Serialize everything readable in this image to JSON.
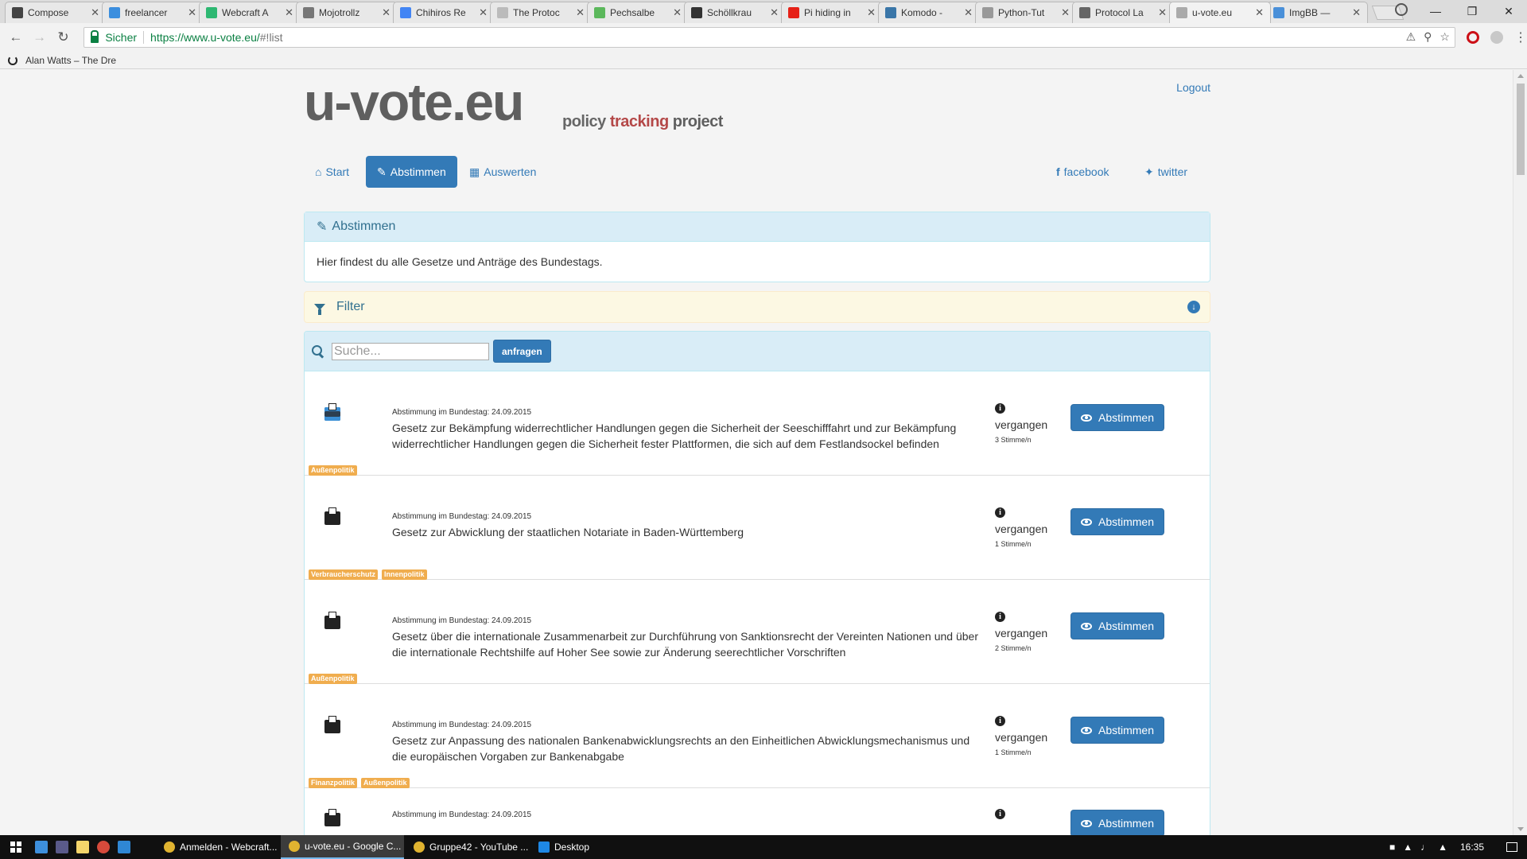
{
  "browser": {
    "tabs": [
      {
        "title": "Compose",
        "color": "#444"
      },
      {
        "title": "freelancer",
        "color": "#3b8ede"
      },
      {
        "title": "Webcraft A",
        "color": "#2eb872"
      },
      {
        "title": "Mojotrollz",
        "color": "#777"
      },
      {
        "title": "Chihiros Re",
        "color": "#4285f4"
      },
      {
        "title": "The Protoc",
        "color": "#bbb"
      },
      {
        "title": "Pechsalbe",
        "color": "#5cb85c"
      },
      {
        "title": "Schöllkrau",
        "color": "#333"
      },
      {
        "title": "Pi hiding in",
        "color": "#e62117"
      },
      {
        "title": "Komodo -",
        "color": "#3a76a8"
      },
      {
        "title": "Python-Tut",
        "color": "#999"
      },
      {
        "title": "Protocol La",
        "color": "#666"
      },
      {
        "title": "u-vote.eu",
        "color": "#aaa"
      },
      {
        "title": "ImgBB —",
        "color": "#4a90d9"
      }
    ],
    "secure_label": "Sicher",
    "url_host": "https://www.u-vote.eu/",
    "url_path": "#!list",
    "bookmark": "Alan Watts – The Dre"
  },
  "site": {
    "logo": "u-vote.eu",
    "tagline_policy": "policy",
    "tagline_tracking": "tracking",
    "tagline_project": "project",
    "logout": "Logout",
    "nav": {
      "start": "Start",
      "vote": "Abstimmen",
      "evaluate": "Auswerten",
      "facebook": "facebook",
      "twitter": "twitter"
    },
    "panel_title": "Abstimmen",
    "panel_text": "Hier findest du alle Gesetze und Anträge des Bundestags.",
    "filter_label": "Filter",
    "search_placeholder": "Suche...",
    "search_button": "anfragen",
    "vote_button": "Abstimmen",
    "status_past": "vergangen"
  },
  "items": [
    {
      "meta": "Abstimmung im Bundestag: 24.09.2015",
      "title": "Gesetz zur Bekämpfung widerrechtlicher Handlungen gegen die Sicherheit der Seeschifffahrt und zur Bekämpfung widerrechtlicher Handlungen gegen die Sicherheit fester Plattformen, die sich auf dem Festlandsockel befinden",
      "votes": "3 Stimme/n",
      "tags": [
        "Außenpolitik"
      ]
    },
    {
      "meta": "Abstimmung im Bundestag: 24.09.2015",
      "title": "Gesetz zur Abwicklung der staatlichen Notariate in Baden-Württemberg",
      "votes": "1 Stimme/n",
      "tags": [
        "Verbraucherschutz",
        "Innenpolitik"
      ]
    },
    {
      "meta": "Abstimmung im Bundestag: 24.09.2015",
      "title": "Gesetz über die internationale Zusammenarbeit zur Durchführung von Sanktionsrecht der Vereinten Nationen und über die internationale Rechtshilfe auf Hoher See sowie zur Änderung seerechtlicher Vorschriften",
      "votes": "2 Stimme/n",
      "tags": [
        "Außenpolitik"
      ]
    },
    {
      "meta": "Abstimmung im Bundestag: 24.09.2015",
      "title": "Gesetz zur Anpassung des nationalen Bankenabwicklungsrechts an den Einheitlichen Abwicklungsmechanismus und die europäischen Vorgaben zur Bankenabgabe",
      "votes": "1 Stimme/n",
      "tags": [
        "Finanzpolitik",
        "Außenpolitik"
      ]
    },
    {
      "meta": "Abstimmung im Bundestag: 24.09.2015",
      "title": "",
      "votes": "",
      "tags": []
    }
  ],
  "taskbar": {
    "tasks": [
      {
        "label": "Anmelden - Webcraft...",
        "active": false
      },
      {
        "label": "u-vote.eu - Google C...",
        "active": true
      },
      {
        "label": "Gruppe42 - YouTube ...",
        "active": false
      },
      {
        "label": "Desktop",
        "active": false
      }
    ],
    "clock": "16:35"
  }
}
